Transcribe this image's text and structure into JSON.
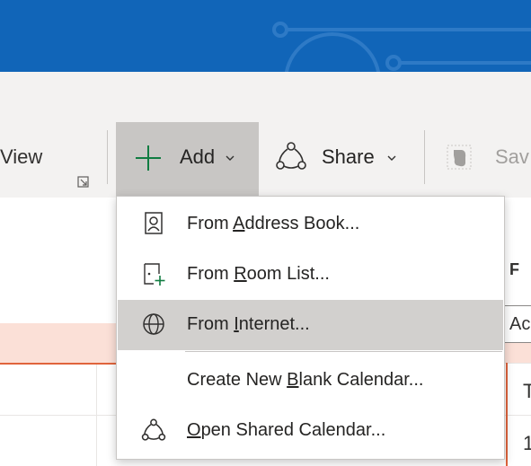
{
  "ribbon": {
    "view_label": "View",
    "add_label": "Add",
    "share_label": "Share",
    "save_label": "Sav"
  },
  "calendar": {
    "column_letter": "F",
    "tooltip_text": "Ac",
    "cell_1": "T",
    "cell_2": "1"
  },
  "menu": {
    "items": [
      {
        "pre": "From ",
        "accel": "A",
        "post": "ddress Book...",
        "icon": "address-book-icon"
      },
      {
        "pre": "From ",
        "accel": "R",
        "post": "oom List...",
        "icon": "room-list-icon"
      },
      {
        "pre": "From ",
        "accel": "I",
        "post": "nternet...",
        "icon": "globe-icon"
      },
      {
        "pre": "Create New ",
        "accel": "B",
        "post": "lank Calendar...",
        "icon": ""
      },
      {
        "pre": "",
        "accel": "O",
        "post": "pen Shared Calendar...",
        "icon": "share-calendar-icon"
      }
    ],
    "highlighted_index": 2
  },
  "colors": {
    "title_bar": "#1165b8",
    "ribbon_bg": "#f3f2f1",
    "add_pressed": "#c8c6c4",
    "add_plus_green": "#107c41",
    "menu_highlight": "#d2d0ce",
    "calendar_header": "#fbe0d7",
    "calendar_accent": "#e0643c"
  }
}
